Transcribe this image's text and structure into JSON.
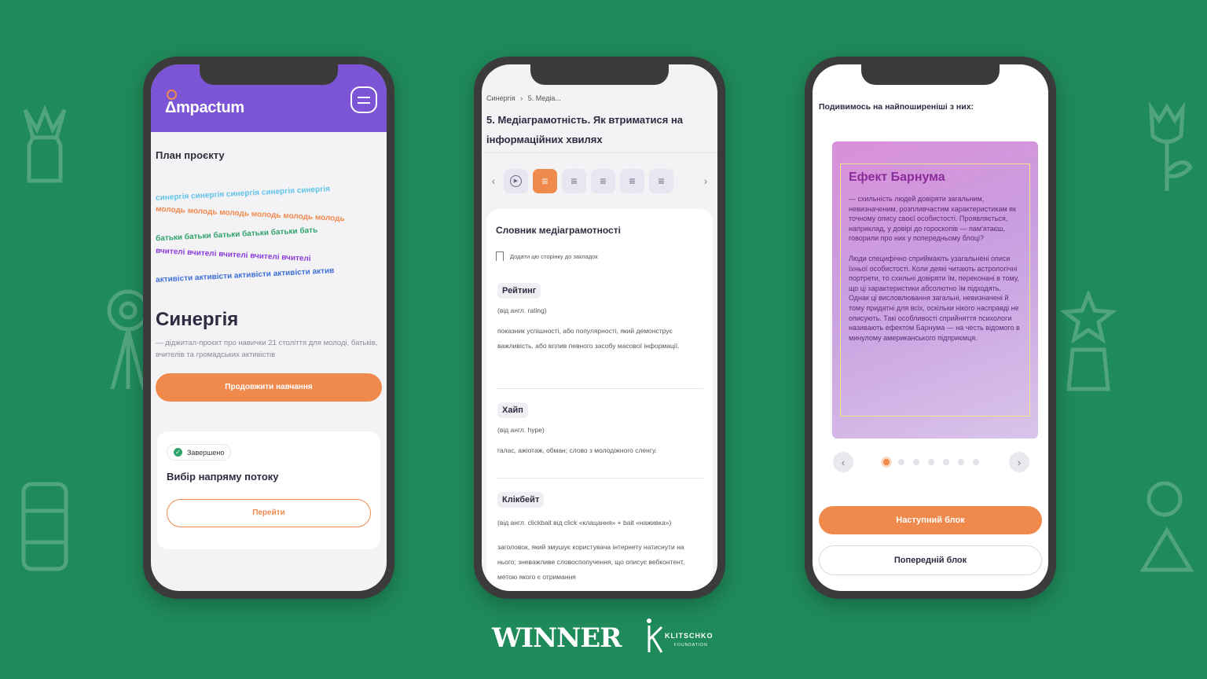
{
  "colors": {
    "background": "#1f8a5a",
    "brand_purple": "#7c54d6",
    "accent_orange": "#f0894c",
    "success_green": "#2fa36b"
  },
  "phone1": {
    "brand": "mpactum",
    "section_title": "План проєкту",
    "wave_rows": [
      "синергія синергія синергія синергія синергія",
      "молодь молодь молодь молодь молодь молодь",
      "батьки батьки батьки батьки батьки бать",
      "вчителі вчителі вчителі вчителі вчителі",
      "активісти активісти активісти активісти актив"
    ],
    "hero_title": "Синергія",
    "hero_desc": "— діджитал-проєкт про навички 21 століття для молоді, батьків, вчителів та громадських активістів",
    "continue_button": "Продовжити навчання",
    "module": {
      "status": "Завершено",
      "title": "Вибір напряму потоку",
      "button": "Перейти"
    }
  },
  "phone2": {
    "breadcrumb": [
      "Синергія",
      "5. Медіа..."
    ],
    "breadcrumb_sep": "›",
    "title": "5. Медіаграмотність. Як втриматися на інформаційних хвилях",
    "tab_icons": [
      "play-icon",
      "text-icon",
      "text-icon",
      "text-icon",
      "text-icon",
      "text-icon"
    ],
    "dict_heading": "Словник медіаграмотності",
    "bookmark_label": "Додати цю сторінку до закладок",
    "terms": [
      {
        "name": "Рейтинг",
        "origin": "(від англ. rating)",
        "definition": "показник успішності, або популярності, який демонструє важливість, або вплив певного засобу масової інформації."
      },
      {
        "name": "Хайп",
        "origin": "(від англ. hype)",
        "definition": "галас, ажіотаж, обман; слово з молодіжного сленгу."
      },
      {
        "name": "Клікбейт",
        "origin": "(від англ. clickbait від click «клацання» + bait «наживка»)",
        "definition": "заголовок, який змушує користувача інтернету натиснути на нього; зневажливе словосполучення, що описує вебконтент, метою якого є отримання"
      }
    ]
  },
  "phone3": {
    "heading": "Подивимось на найпоширеніші з них:",
    "card_title": "Ефект Барнума",
    "card_paragraph_1": "— схильність людей довіряти загальним, невизначеним, розпливчастим характеристикам як точному опису своєї особистості. Проявляється, наприклад, у довірі до гороскопів — пам'ятаєш, говорили про них у попередньому блоці?",
    "card_paragraph_2": "Люди специфічно сприймають узагальнені описи їхньої особистості. Коли деякі читають астрологічні портрети, то схильні довіряти їм, переконані в тому, що ці характеристики абсолютно їм підходять. Однак ці висловлювання загальні, невизначені й тому придатні для всіх, оскільки нікого насправді не описують. Такі особливості сприйняття психологи називають ефектом Барнума — на честь відомого в минулому американського підприємця.",
    "dots_total": 7,
    "dots_active_index": 0,
    "next_button": "Наступний блок",
    "prev_button": "Попередній блок"
  },
  "footer": {
    "sponsor_1": "WINNER",
    "sponsor_2_name": "KLITSCHKO",
    "sponsor_2_sub": "FOUNDATION"
  }
}
